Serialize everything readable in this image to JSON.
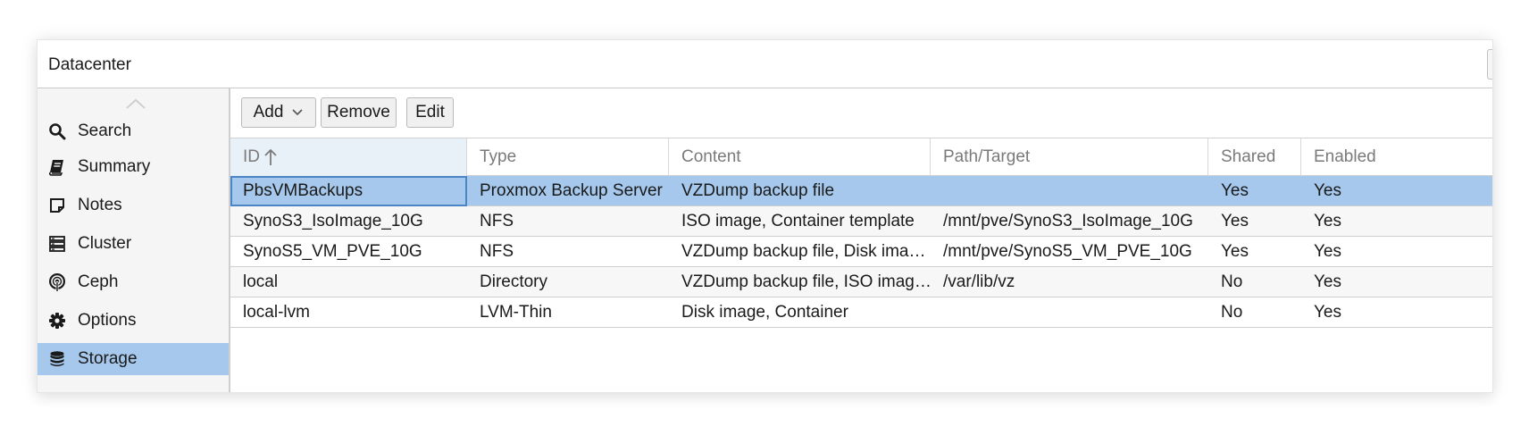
{
  "window": {
    "title": "Datacenter"
  },
  "sidebar": {
    "items": [
      {
        "label": "Search",
        "icon": "search-icon"
      },
      {
        "label": "Summary",
        "icon": "book-icon"
      },
      {
        "label": "Notes",
        "icon": "note-icon"
      },
      {
        "label": "Cluster",
        "icon": "server-icon"
      },
      {
        "label": "Ceph",
        "icon": "ceph-icon"
      },
      {
        "label": "Options",
        "icon": "gear-icon"
      },
      {
        "label": "Storage",
        "icon": "database-icon",
        "active": true
      }
    ]
  },
  "toolbar": {
    "add_label": "Add",
    "remove_label": "Remove",
    "edit_label": "Edit"
  },
  "table": {
    "columns": [
      "ID",
      "Type",
      "Content",
      "Path/Target",
      "Shared",
      "Enabled"
    ],
    "sorted_column": "ID",
    "sort_direction": "ascending",
    "rows": [
      {
        "id": "PbsVMBackups",
        "type": "Proxmox Backup Server",
        "content": "VZDump backup file",
        "path": "",
        "shared": "Yes",
        "enabled": "Yes"
      },
      {
        "id": "SynoS3_IsoImage_10G",
        "type": "NFS",
        "content": "ISO image, Container template",
        "path": "/mnt/pve/SynoS3_IsoImage_10G",
        "shared": "Yes",
        "enabled": "Yes"
      },
      {
        "id": "SynoS5_VM_PVE_10G",
        "type": "NFS",
        "content": "VZDump backup file, Disk ima…",
        "path": "/mnt/pve/SynoS5_VM_PVE_10G",
        "shared": "Yes",
        "enabled": "Yes"
      },
      {
        "id": "local",
        "type": "Directory",
        "content": "VZDump backup file, ISO imag…",
        "path": "/var/lib/vz",
        "shared": "No",
        "enabled": "Yes"
      },
      {
        "id": "local-lvm",
        "type": "LVM-Thin",
        "content": "Disk image, Container",
        "path": "",
        "shared": "No",
        "enabled": "Yes"
      }
    ],
    "selected_row": 0
  },
  "colors": {
    "selection": "#a5c8ec",
    "focus_border": "#4a86c6",
    "header_text": "#7a7a7a"
  }
}
